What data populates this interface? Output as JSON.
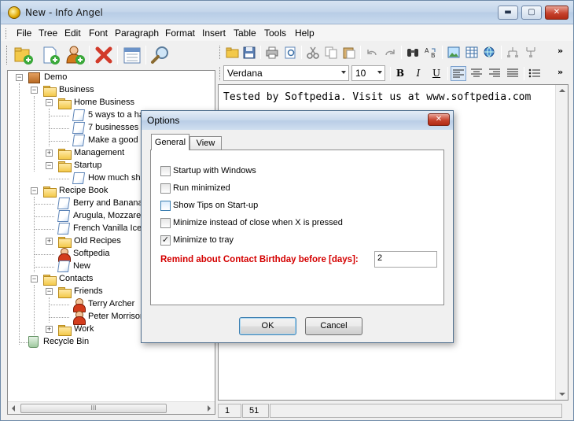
{
  "window": {
    "title": "New - Info Angel",
    "min_glyph": "▬",
    "max_glyph": "▢",
    "close_glyph": "✕"
  },
  "menu": [
    "File",
    "Tree",
    "Edit",
    "Font",
    "Paragraph",
    "Format",
    "Insert",
    "Table",
    "Tools",
    "Help"
  ],
  "format_bar": {
    "font": "Verdana",
    "size": "10",
    "bold": "B",
    "italic": "I",
    "underline": "U"
  },
  "tree": {
    "items": [
      {
        "label": "Demo",
        "icon": "box-icon"
      },
      {
        "label": "Business",
        "icon": "folder-icon"
      },
      {
        "label": "Home Business",
        "icon": "folder-icon"
      },
      {
        "label": "5 ways to a ha",
        "icon": "document-icon"
      },
      {
        "label": "7 businesses p",
        "icon": "document-icon"
      },
      {
        "label": "Make a good h",
        "icon": "document-icon"
      },
      {
        "label": "Management",
        "icon": "folder-icon"
      },
      {
        "label": "Startup",
        "icon": "folder-icon"
      },
      {
        "label": "How much sho",
        "icon": "document-icon"
      },
      {
        "label": "Recipe Book",
        "icon": "folder-icon"
      },
      {
        "label": "Berry and Banana",
        "icon": "document-icon"
      },
      {
        "label": "Arugula, Mozzarell",
        "icon": "document-icon"
      },
      {
        "label": "French Vanilla Ice",
        "icon": "document-icon"
      },
      {
        "label": "Old Recipes",
        "icon": "folder-icon"
      },
      {
        "label": "Softpedia",
        "icon": "person-icon"
      },
      {
        "label": "New",
        "icon": "document-icon"
      },
      {
        "label": "Contacts",
        "icon": "folder-icon"
      },
      {
        "label": "Friends",
        "icon": "folder-icon"
      },
      {
        "label": "Terry Archer",
        "icon": "person-icon"
      },
      {
        "label": "Peter Morrison",
        "icon": "person-icon"
      },
      {
        "label": "Work",
        "icon": "folder-icon"
      },
      {
        "label": "Recycle Bin",
        "icon": "recycle-bin-icon"
      }
    ],
    "scroll_grip": "III"
  },
  "editor": {
    "text": "Tested by Softpedia. Visit us at www.softpedia.com"
  },
  "status": {
    "line": "1",
    "col": "51"
  },
  "dialog": {
    "title": "Options",
    "close_glyph": "✕",
    "tabs": [
      "General",
      "View"
    ],
    "options": [
      {
        "label": "Startup with Windows",
        "checked": false
      },
      {
        "label": "Run minimized",
        "checked": false
      },
      {
        "label": "Show Tips on Start-up",
        "checked": false
      },
      {
        "label": "Minimize instead of close when X is pressed",
        "checked": false
      },
      {
        "label": "Minimize to tray",
        "checked": true
      }
    ],
    "remind_label": "Remind about Contact Birthday before [days]:",
    "remind_value": "2",
    "ok": "OK",
    "cancel": "Cancel"
  }
}
